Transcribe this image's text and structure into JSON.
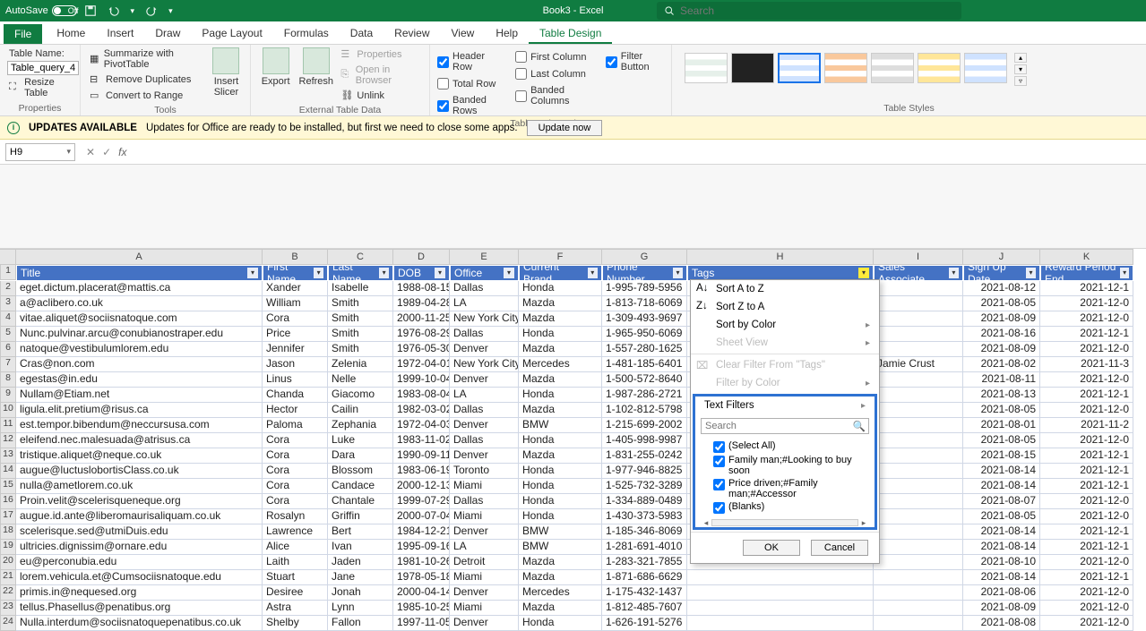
{
  "titlebar": {
    "autosave_label": "AutoSave",
    "autosave_state": "Off",
    "doc_title": "Book3 - Excel",
    "search_placeholder": "Search"
  },
  "tabs": {
    "file": "File",
    "items": [
      "Home",
      "Insert",
      "Draw",
      "Page Layout",
      "Formulas",
      "Data",
      "Review",
      "View",
      "Help",
      "Table Design"
    ],
    "active": "Table Design"
  },
  "ribbon": {
    "properties": {
      "label": "Properties",
      "table_name_label": "Table Name:",
      "table_name_value": "Table_query_4",
      "resize": "Resize Table"
    },
    "tools": {
      "label": "Tools",
      "pivot": "Summarize with PivotTable",
      "dupes": "Remove Duplicates",
      "range": "Convert to Range",
      "slicer": "Insert Slicer"
    },
    "ext": {
      "label": "External Table Data",
      "export": "Export",
      "refresh": "Refresh",
      "props": "Properties",
      "browser": "Open in Browser",
      "unlink": "Unlink"
    },
    "style_opts": {
      "label": "Table Style Options",
      "header_row": "Header Row",
      "total_row": "Total Row",
      "banded_rows": "Banded Rows",
      "first_col": "First Column",
      "last_col": "Last Column",
      "banded_cols": "Banded Columns",
      "filter_btn": "Filter Button",
      "checked": {
        "header_row": true,
        "total_row": false,
        "banded_rows": true,
        "first_col": false,
        "last_col": false,
        "banded_cols": false,
        "filter_btn": true
      }
    },
    "styles": {
      "label": "Table Styles"
    }
  },
  "msgbar": {
    "title": "UPDATES AVAILABLE",
    "text": "Updates for Office are ready to be installed, but first we need to close some apps.",
    "button": "Update now"
  },
  "namebox": "H9",
  "columns_letters": [
    "A",
    "B",
    "C",
    "D",
    "E",
    "F",
    "G",
    "H",
    "I",
    "J",
    "K"
  ],
  "headers": [
    "Title",
    "First Name",
    "Last Name",
    "DOB",
    "Office",
    "Current Brand",
    "Phone Number",
    "Tags",
    "Sales Associate",
    "Sign Up Date",
    "Reward Period End"
  ],
  "rows": [
    {
      "n": 2,
      "c": [
        "eget.dictum.placerat@mattis.ca",
        "Xander",
        "Isabelle",
        "1988-08-15",
        "Dallas",
        "Honda",
        "1-995-789-5956",
        "",
        "",
        "2021-08-12",
        "2021-12-1"
      ]
    },
    {
      "n": 3,
      "c": [
        "a@aclibero.co.uk",
        "William",
        "Smith",
        "1989-04-28",
        "LA",
        "Mazda",
        "1-813-718-6069",
        "",
        "",
        "2021-08-05",
        "2021-12-0"
      ]
    },
    {
      "n": 4,
      "c": [
        "vitae.aliquet@sociisnatoque.com",
        "Cora",
        "Smith",
        "2000-11-25",
        "New York City",
        "Mazda",
        "1-309-493-9697",
        "",
        "",
        "2021-08-09",
        "2021-12-0"
      ]
    },
    {
      "n": 5,
      "c": [
        "Nunc.pulvinar.arcu@conubianostraper.edu",
        "Price",
        "Smith",
        "1976-08-29",
        "Dallas",
        "Honda",
        "1-965-950-6069",
        "",
        "",
        "2021-08-16",
        "2021-12-1"
      ]
    },
    {
      "n": 6,
      "c": [
        "natoque@vestibulumlorem.edu",
        "Jennifer",
        "Smith",
        "1976-05-30",
        "Denver",
        "Mazda",
        "1-557-280-1625",
        "",
        "",
        "2021-08-09",
        "2021-12-0"
      ]
    },
    {
      "n": 7,
      "c": [
        "Cras@non.com",
        "Jason",
        "Zelenia",
        "1972-04-01",
        "New York City",
        "Mercedes",
        "1-481-185-6401",
        "",
        "Jamie Crust",
        "2021-08-02",
        "2021-11-3"
      ]
    },
    {
      "n": 8,
      "c": [
        "egestas@in.edu",
        "Linus",
        "Nelle",
        "1999-10-04",
        "Denver",
        "Mazda",
        "1-500-572-8640",
        "",
        "",
        "2021-08-11",
        "2021-12-0"
      ]
    },
    {
      "n": 9,
      "c": [
        "Nullam@Etiam.net",
        "Chanda",
        "Giacomo",
        "1983-08-04",
        "LA",
        "Honda",
        "1-987-286-2721",
        "",
        "",
        "2021-08-13",
        "2021-12-1"
      ]
    },
    {
      "n": 10,
      "c": [
        "ligula.elit.pretium@risus.ca",
        "Hector",
        "Cailin",
        "1982-03-02",
        "Dallas",
        "Mazda",
        "1-102-812-5798",
        "",
        "",
        "2021-08-05",
        "2021-12-0"
      ]
    },
    {
      "n": 11,
      "c": [
        "est.tempor.bibendum@neccursusa.com",
        "Paloma",
        "Zephania",
        "1972-04-03",
        "Denver",
        "BMW",
        "1-215-699-2002",
        "",
        "",
        "2021-08-01",
        "2021-11-2"
      ]
    },
    {
      "n": 12,
      "c": [
        "eleifend.nec.malesuada@atrisus.ca",
        "Cora",
        "Luke",
        "1983-11-02",
        "Dallas",
        "Honda",
        "1-405-998-9987",
        "",
        "",
        "2021-08-05",
        "2021-12-0"
      ]
    },
    {
      "n": 13,
      "c": [
        "tristique.aliquet@neque.co.uk",
        "Cora",
        "Dara",
        "1990-09-11",
        "Denver",
        "Mazda",
        "1-831-255-0242",
        "",
        "",
        "2021-08-15",
        "2021-12-1"
      ]
    },
    {
      "n": 14,
      "c": [
        "augue@luctuslobortisClass.co.uk",
        "Cora",
        "Blossom",
        "1983-06-19",
        "Toronto",
        "Honda",
        "1-977-946-8825",
        "",
        "",
        "2021-08-14",
        "2021-12-1"
      ]
    },
    {
      "n": 15,
      "c": [
        "nulla@ametlorem.co.uk",
        "Cora",
        "Candace",
        "2000-12-13",
        "Miami",
        "Honda",
        "1-525-732-3289",
        "",
        "",
        "2021-08-14",
        "2021-12-1"
      ]
    },
    {
      "n": 16,
      "c": [
        "Proin.velit@scelerisqueneque.org",
        "Cora",
        "Chantale",
        "1999-07-29",
        "Dallas",
        "Honda",
        "1-334-889-0489",
        "",
        "",
        "2021-08-07",
        "2021-12-0"
      ]
    },
    {
      "n": 17,
      "c": [
        "augue.id.ante@liberomaurisaliquam.co.uk",
        "Rosalyn",
        "Griffin",
        "2000-07-04",
        "Miami",
        "Honda",
        "1-430-373-5983",
        "",
        "",
        "2021-08-05",
        "2021-12-0"
      ]
    },
    {
      "n": 18,
      "c": [
        "scelerisque.sed@utmiDuis.edu",
        "Lawrence",
        "Bert",
        "1984-12-21",
        "Denver",
        "BMW",
        "1-185-346-8069",
        "",
        "",
        "2021-08-14",
        "2021-12-1"
      ]
    },
    {
      "n": 19,
      "c": [
        "ultricies.dignissim@ornare.edu",
        "Alice",
        "Ivan",
        "1995-09-16",
        "LA",
        "BMW",
        "1-281-691-4010",
        "",
        "",
        "2021-08-14",
        "2021-12-1"
      ]
    },
    {
      "n": 20,
      "c": [
        "eu@perconubia.edu",
        "Laith",
        "Jaden",
        "1981-10-26",
        "Detroit",
        "Mazda",
        "1-283-321-7855",
        "",
        "",
        "2021-08-10",
        "2021-12-0"
      ]
    },
    {
      "n": 21,
      "c": [
        "lorem.vehicula.et@Cumsociisnatoque.edu",
        "Stuart",
        "Jane",
        "1978-05-18",
        "Miami",
        "Mazda",
        "1-871-686-6629",
        "",
        "",
        "2021-08-14",
        "2021-12-1"
      ]
    },
    {
      "n": 22,
      "c": [
        "primis.in@nequesed.org",
        "Desiree",
        "Jonah",
        "2000-04-14",
        "Denver",
        "Mercedes",
        "1-175-432-1437",
        "",
        "",
        "2021-08-06",
        "2021-12-0"
      ]
    },
    {
      "n": 23,
      "c": [
        "tellus.Phasellus@penatibus.org",
        "Astra",
        "Lynn",
        "1985-10-25",
        "Miami",
        "Mazda",
        "1-812-485-7607",
        "",
        "",
        "2021-08-09",
        "2021-12-0"
      ]
    },
    {
      "n": 24,
      "c": [
        "Nulla.interdum@sociisnatoquepenatibus.co.uk",
        "Shelby",
        "Fallon",
        "1997-11-05",
        "Denver",
        "Honda",
        "1-626-191-5276",
        "",
        "",
        "2021-08-08",
        "2021-12-0"
      ]
    }
  ],
  "filter": {
    "sort_az": "Sort A to Z",
    "sort_za": "Sort Z to A",
    "sort_color": "Sort by Color",
    "sheet_view": "Sheet View",
    "clear": "Clear Filter From \"Tags\"",
    "by_color": "Filter by Color",
    "text_filters": "Text Filters",
    "search_ph": "Search",
    "items": [
      {
        "label": "(Select All)",
        "checked": true
      },
      {
        "label": "Family man;#Looking to buy soon",
        "checked": true
      },
      {
        "label": "Price driven;#Family man;#Accessor",
        "checked": true
      },
      {
        "label": "(Blanks)",
        "checked": true
      }
    ],
    "ok": "OK",
    "cancel": "Cancel"
  }
}
